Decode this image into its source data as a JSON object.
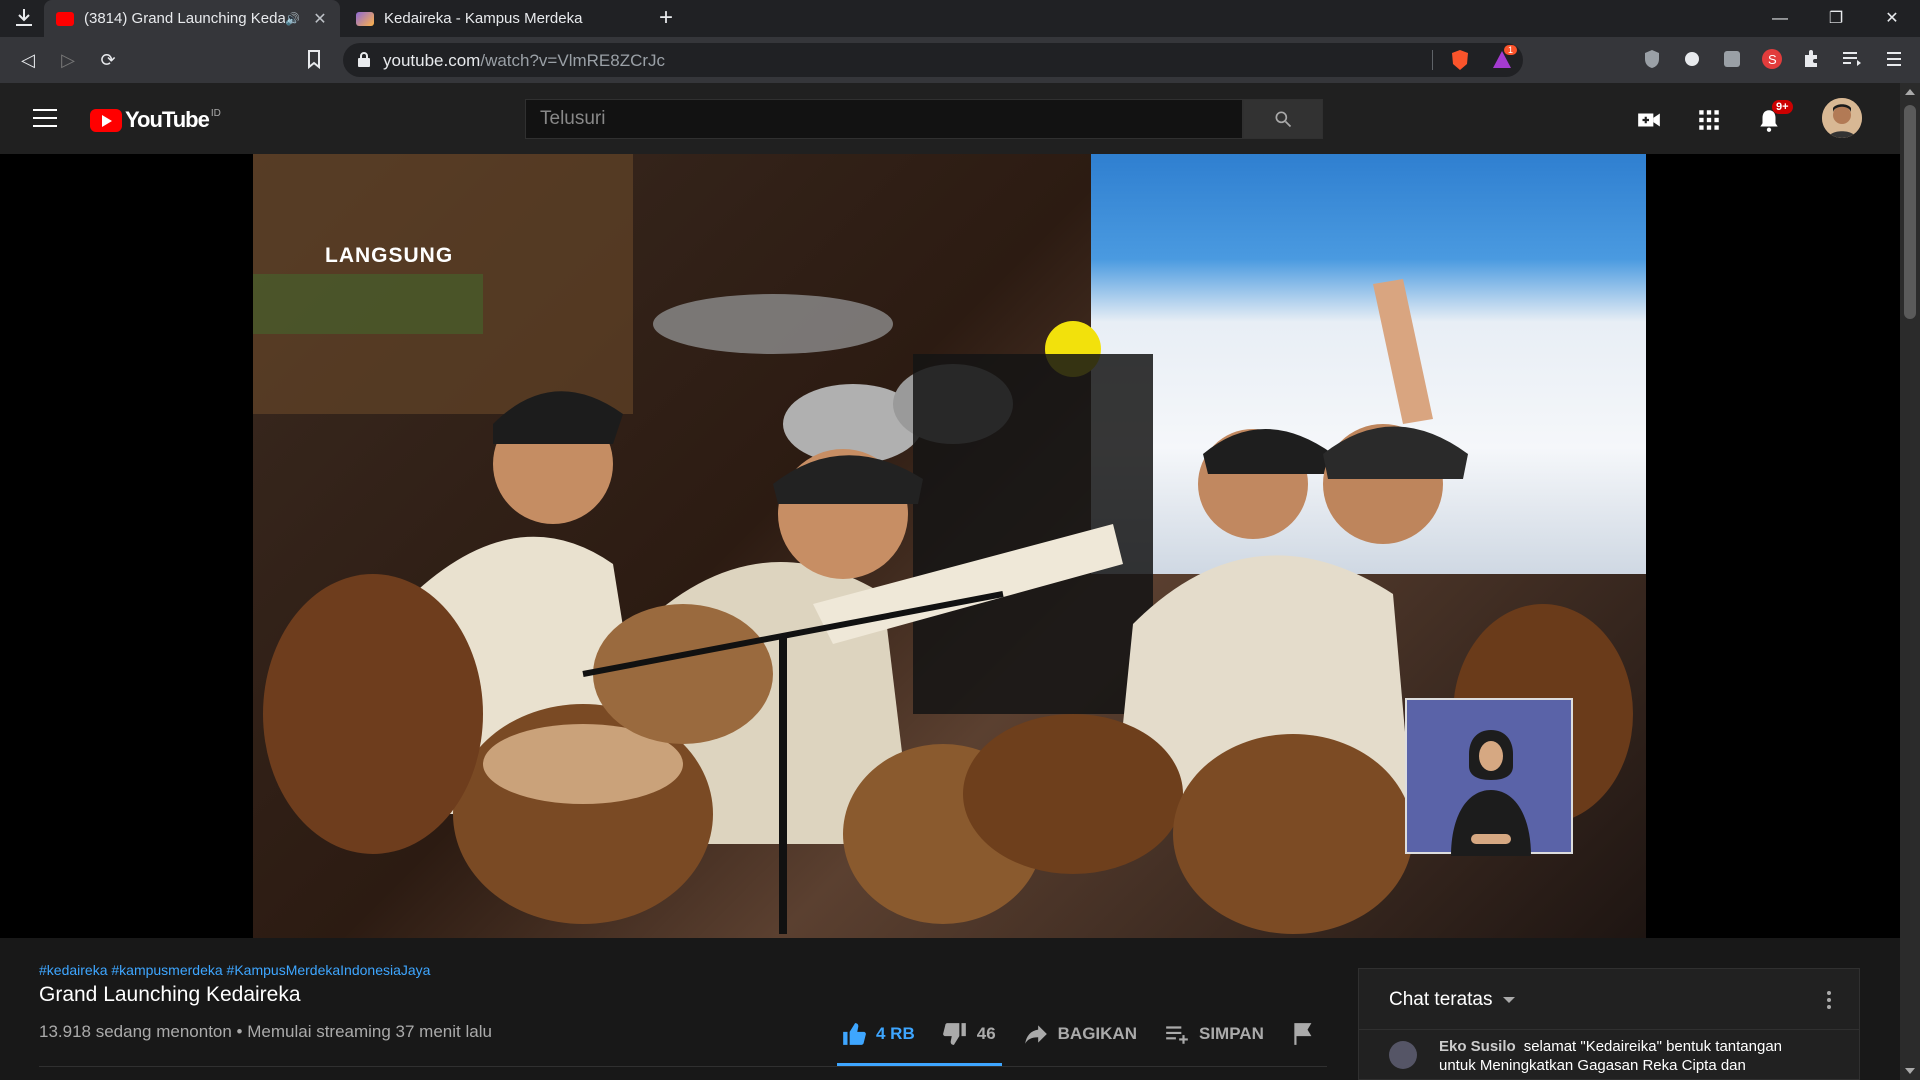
{
  "browser": {
    "tabs": [
      {
        "title": "(3814) Grand Launching Keda",
        "active": true
      },
      {
        "title": "Kedaireka - Kampus Merdeka",
        "active": false
      }
    ],
    "url_host": "youtube.com",
    "url_path": "/watch?v=VlmRE8ZCrJc",
    "ext_badge": "1"
  },
  "youtube": {
    "logo_text": "YouTube",
    "country": "ID",
    "search_placeholder": "Telusuri",
    "notif_badge": "9+"
  },
  "video": {
    "live_label": "LANGSUNG"
  },
  "info": {
    "hashtags": "#kedaireka #kampusmerdeka #KampusMerdekaIndonesiaJaya",
    "title": "Grand Launching Kedaireka",
    "meta": "13.918 sedang menonton • Memulai streaming 37 menit lalu",
    "like_count": "4 RB",
    "dislike_count": "46",
    "share_label": "BAGIKAN",
    "save_label": "SIMPAN"
  },
  "chat": {
    "header": "Chat teratas",
    "message": {
      "author": "Eko Susilo",
      "text": "selamat \"Kedaireika\" bentuk tantangan untuk Meningkatkan Gagasan Reka Cipta dan"
    }
  },
  "colors": {
    "accent_blue": "#3ea6ff",
    "youtube_red": "#ff0000",
    "badge_red": "#cc0000"
  }
}
